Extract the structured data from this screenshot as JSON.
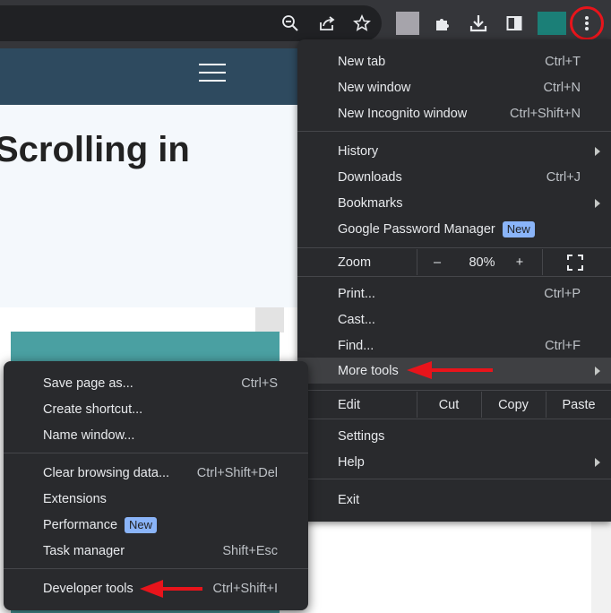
{
  "toolbar": {
    "icons": [
      "zoom-out-icon",
      "share-icon",
      "star-icon",
      "extensions-icon",
      "download-icon",
      "side-panel-icon",
      "menu-icon"
    ],
    "colors": {
      "accent_circle": "#e8141b",
      "ext_teal": "#1b7f77"
    }
  },
  "page": {
    "hero_title": "Scrolling in"
  },
  "main_menu": {
    "new_tab": {
      "label": "New tab",
      "shortcut": "Ctrl+T"
    },
    "new_window": {
      "label": "New window",
      "shortcut": "Ctrl+N"
    },
    "incognito": {
      "label": "New Incognito window",
      "shortcut": "Ctrl+Shift+N"
    },
    "history": {
      "label": "History"
    },
    "downloads": {
      "label": "Downloads",
      "shortcut": "Ctrl+J"
    },
    "bookmarks": {
      "label": "Bookmarks"
    },
    "password_manager": {
      "label": "Google Password Manager",
      "badge": "New"
    },
    "zoom": {
      "label": "Zoom",
      "minus": "–",
      "value": "80%",
      "plus": "+"
    },
    "print": {
      "label": "Print...",
      "shortcut": "Ctrl+P"
    },
    "cast": {
      "label": "Cast..."
    },
    "find": {
      "label": "Find...",
      "shortcut": "Ctrl+F"
    },
    "more_tools": {
      "label": "More tools"
    },
    "edit": {
      "label": "Edit",
      "cut": "Cut",
      "copy": "Copy",
      "paste": "Paste"
    },
    "settings": {
      "label": "Settings"
    },
    "help": {
      "label": "Help"
    },
    "exit": {
      "label": "Exit"
    }
  },
  "sub_menu": {
    "save_page": {
      "label": "Save page as...",
      "shortcut": "Ctrl+S"
    },
    "create_shortcut": {
      "label": "Create shortcut..."
    },
    "name_window": {
      "label": "Name window..."
    },
    "clear_data": {
      "label": "Clear browsing data...",
      "shortcut": "Ctrl+Shift+Del"
    },
    "extensions": {
      "label": "Extensions"
    },
    "performance": {
      "label": "Performance",
      "badge": "New"
    },
    "task_manager": {
      "label": "Task manager",
      "shortcut": "Shift+Esc"
    },
    "developer_tools": {
      "label": "Developer tools",
      "shortcut": "Ctrl+Shift+I"
    }
  }
}
